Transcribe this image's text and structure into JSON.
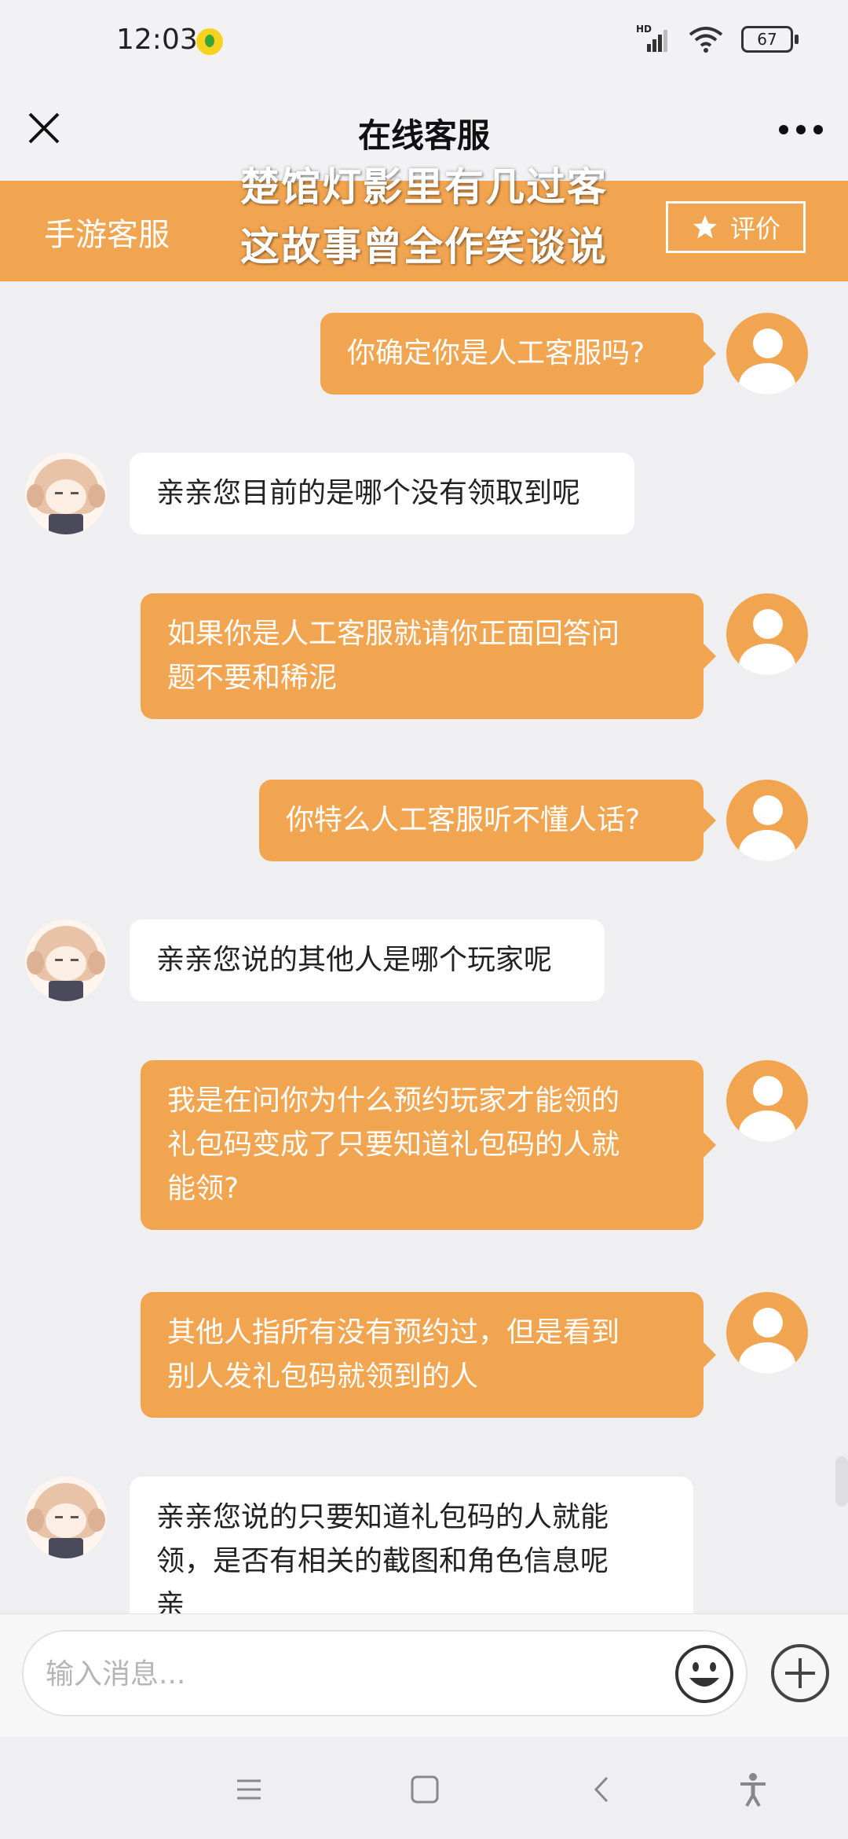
{
  "status_bar": {
    "time": "12:03",
    "network": "HD",
    "battery": "67"
  },
  "title_bar": {
    "title": "在线客服"
  },
  "header": {
    "service_label": "手游客服",
    "rate_label": "评价"
  },
  "caption": {
    "line1": "楚馆灯影里有几过客",
    "line2": "这故事曾全作笑谈说"
  },
  "messages": [
    {
      "from": "user",
      "lines": [
        "你确定你是人工客服吗?"
      ]
    },
    {
      "from": "agent",
      "lines": [
        "亲亲您目前的是哪个没有领取到呢"
      ]
    },
    {
      "from": "user",
      "lines": [
        "如果你是人工客服就请你正面回答问",
        "题不要和稀泥"
      ]
    },
    {
      "from": "user",
      "lines": [
        "你特么人工客服听不懂人话?"
      ]
    },
    {
      "from": "agent",
      "lines": [
        "亲亲您说的其他人是哪个玩家呢"
      ]
    },
    {
      "from": "user",
      "lines": [
        "我是在问你为什么预约玩家才能领的",
        "礼包码变成了只要知道礼包码的人就",
        "能领?"
      ]
    },
    {
      "from": "user",
      "lines": [
        "其他人指所有没有预约过，但是看到",
        "别人发礼包码就领到的人"
      ]
    },
    {
      "from": "agent",
      "lines": [
        "亲亲您说的只要知道礼包码的人就能",
        "领，是否有相关的截图和角色信息呢",
        "亲"
      ]
    }
  ],
  "input": {
    "placeholder": "输入消息..."
  },
  "icons": {
    "close": "close-icon",
    "more": "more-icon",
    "star": "star-icon",
    "emoji": "emoji-icon",
    "plus": "plus-icon",
    "nav_menu": "menu-icon",
    "nav_home": "home-icon",
    "nav_back": "back-icon",
    "nav_accessibility": "accessibility-icon"
  },
  "colors": {
    "accent": "#f2a550",
    "background": "#efeff1",
    "agent_bubble": "#ffffff"
  }
}
